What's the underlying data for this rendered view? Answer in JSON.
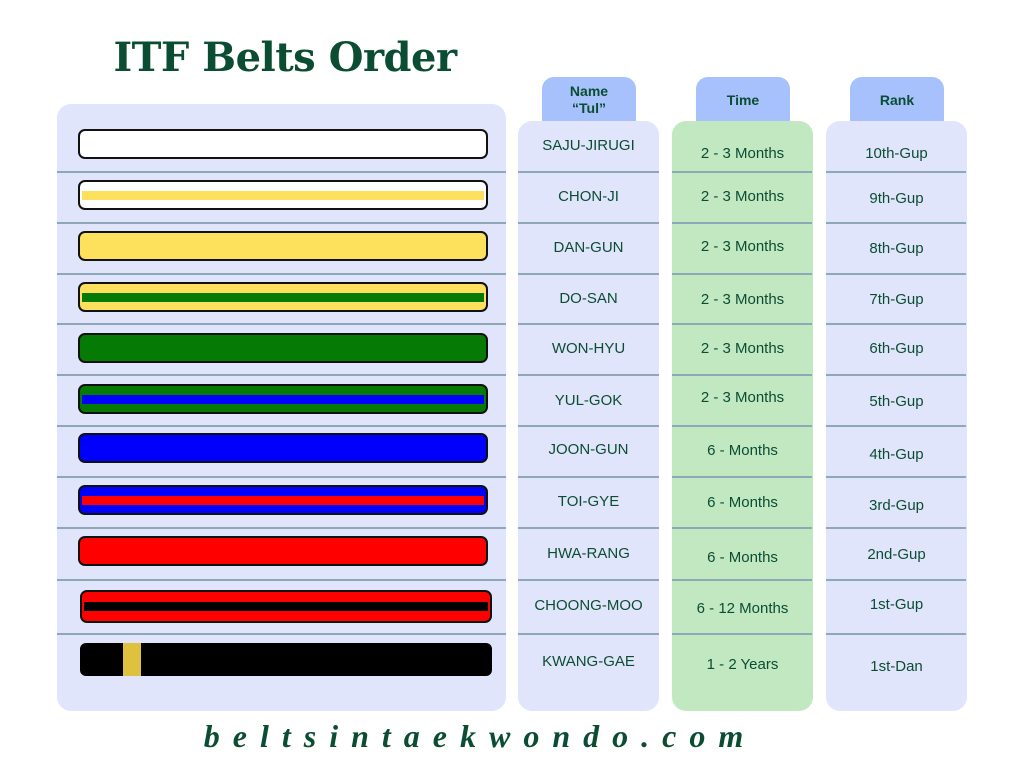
{
  "title": "ITF Belts Order",
  "footer": "beltsintaekwondo.com",
  "colors": {
    "title": "#0b4d33",
    "panel_bg": "#e0e5fb",
    "time_bg": "#c1e8c1",
    "header_bg": "#a6c1fb"
  },
  "headers": {
    "name": "Name\n“Tul”",
    "time": "Time",
    "rank": "Rank"
  },
  "rows": [
    {
      "belt": {
        "base": "#ffffff",
        "stripe": null
      },
      "name": "SAJU-JIRUGI",
      "time": "2 - 3 Months",
      "rank": "10th-Gup"
    },
    {
      "belt": {
        "base": "#ffffff",
        "stripe": "#fde05c"
      },
      "name": "CHON-JI",
      "time": "2 - 3 Months",
      "rank": "9th-Gup"
    },
    {
      "belt": {
        "base": "#fde05c",
        "stripe": null
      },
      "name": "DAN-GUN",
      "time": "2 - 3 Months",
      "rank": "8th-Gup"
    },
    {
      "belt": {
        "base": "#fde05c",
        "stripe": "#057a05"
      },
      "name": "DO-SAN",
      "time": "2 - 3 Months",
      "rank": "7th-Gup"
    },
    {
      "belt": {
        "base": "#057a05",
        "stripe": null
      },
      "name": "WON-HYU",
      "time": "2 - 3 Months",
      "rank": "6th-Gup"
    },
    {
      "belt": {
        "base": "#057a05",
        "stripe": "#0000ff"
      },
      "name": "YUL-GOK",
      "time": "2 - 3 Months",
      "rank": "5th-Gup"
    },
    {
      "belt": {
        "base": "#0000ff",
        "stripe": null
      },
      "name": "JOON-GUN",
      "time": "6 - Months",
      "rank": "4th-Gup"
    },
    {
      "belt": {
        "base": "#0000ff",
        "stripe": "#ff0000"
      },
      "name": "TOI-GYE",
      "time": "6 - Months",
      "rank": "3rd-Gup"
    },
    {
      "belt": {
        "base": "#ff0000",
        "stripe": null
      },
      "name": "HWA-RANG",
      "time": "6 - Months",
      "rank": "2nd-Gup"
    },
    {
      "belt": {
        "base": "#ff0000",
        "stripe": "#000000"
      },
      "name": "CHOONG-MOO",
      "time": "6 - 12 Months",
      "rank": "1st-Gup"
    },
    {
      "belt": {
        "base": "#000000",
        "stripe": null,
        "bar": "#dfc140"
      },
      "name": "KWANG-GAE",
      "time": "1 - 2 Years",
      "rank": "1st-Dan"
    }
  ]
}
